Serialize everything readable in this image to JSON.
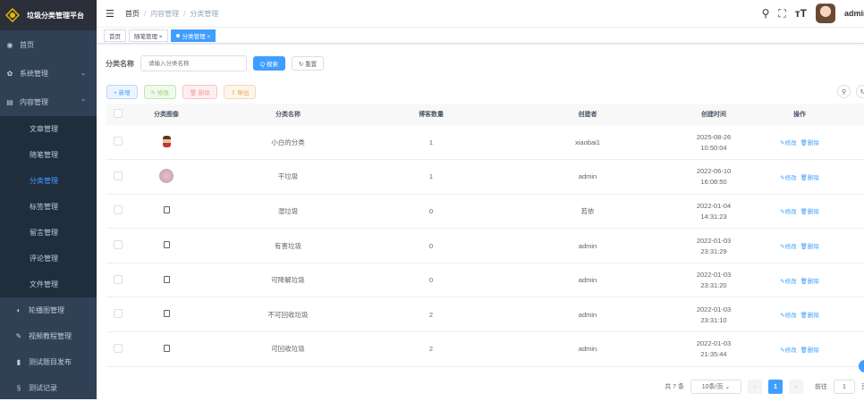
{
  "app_title": "垃圾分类管理平台",
  "sidebar": {
    "items": [
      {
        "label": "首页",
        "icon": "dashboard-icon"
      },
      {
        "label": "系统管理",
        "icon": "gear-icon"
      },
      {
        "label": "内容管理",
        "icon": "document-icon"
      }
    ],
    "sub_items": [
      "文章管理",
      "随笔管理",
      "分类管理",
      "标签管理",
      "留言管理",
      "评论管理",
      "文件管理"
    ],
    "more_items": [
      {
        "label": "轮播图管理",
        "icon": "carousel-icon"
      },
      {
        "label": "视频教程管理",
        "icon": "video-icon"
      },
      {
        "label": "测试题目发布",
        "icon": "quiz-icon"
      },
      {
        "label": "测试记录",
        "icon": "record-icon"
      }
    ]
  },
  "breadcrumb": [
    "首页",
    "内容管理",
    "分类管理"
  ],
  "user": {
    "name": "admin"
  },
  "tags": [
    {
      "label": "首页"
    },
    {
      "label": "随笔管理 ×"
    },
    {
      "label": "分类管理 ×"
    }
  ],
  "search": {
    "label": "分类名称",
    "placeholder": "请输入分类名称",
    "search_btn": "Q 搜索",
    "reset_btn": "↻ 重置"
  },
  "toolbar": {
    "add": "+ 新增",
    "edit": "✎ 修改",
    "delete": "🗑 删除",
    "export": "⇩ 导出"
  },
  "table": {
    "headers": [
      "分类图像",
      "分类名称",
      "博客数量",
      "创建者",
      "创建时间",
      "操作"
    ],
    "rows": [
      {
        "name": "小白的分类",
        "count": "1",
        "creator": "xiaobai1",
        "date": "2025-08-26",
        "time": "10:50:04",
        "img": "img1"
      },
      {
        "name": "干垃圾",
        "count": "1",
        "creator": "admin",
        "date": "2022-06-10",
        "time": "16:08:50",
        "img": "img2"
      },
      {
        "name": "湿垃圾",
        "count": "0",
        "creator": "若依",
        "date": "2022-01-04",
        "time": "14:31:23",
        "img": "img3"
      },
      {
        "name": "有害垃圾",
        "count": "0",
        "creator": "admin",
        "date": "2022-01-03",
        "time": "23:31:29",
        "img": "img3"
      },
      {
        "name": "可降解垃圾",
        "count": "0",
        "creator": "admin",
        "date": "2022-01-03",
        "time": "23:31:20",
        "img": "img3"
      },
      {
        "name": "不可回收垃圾",
        "count": "2",
        "creator": "admin",
        "date": "2022-01-03",
        "time": "23:31:10",
        "img": "img3"
      },
      {
        "name": "可回收垃圾",
        "count": "2",
        "creator": "admin",
        "date": "2022-01-03",
        "time": "21:35:44",
        "img": "img3"
      }
    ],
    "edit_label": "✎修改",
    "delete_label": "🗑删除"
  },
  "pagination": {
    "total": "共 7 条",
    "page_size": "10条/页 ⌄",
    "prev": "‹",
    "current": "1",
    "next": "›",
    "goto": "前往",
    "goto_value": "1",
    "page_unit": "页"
  }
}
